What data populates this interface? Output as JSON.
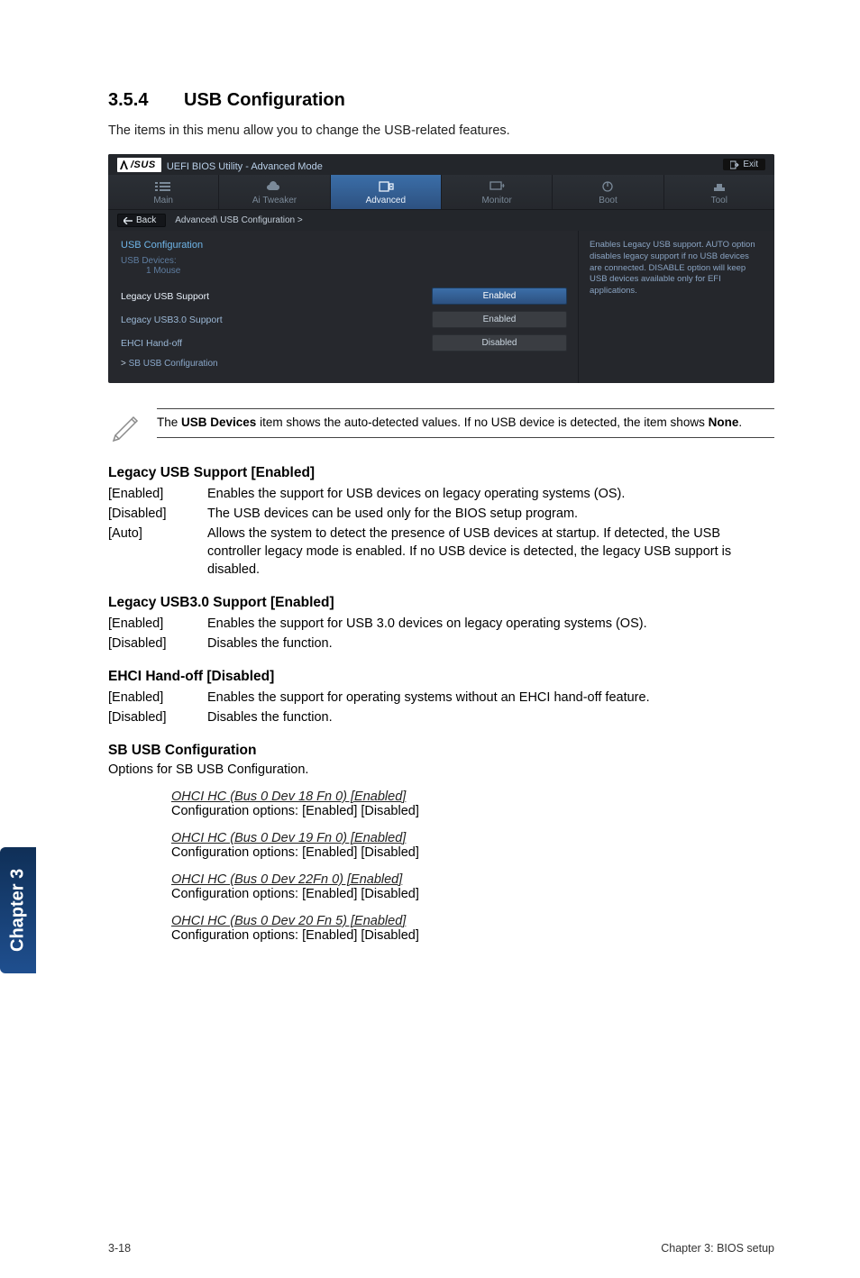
{
  "heading": {
    "number": "3.5.4",
    "title": "USB Configuration"
  },
  "intro": "The items in this menu allow you to change the USB-related features.",
  "bios": {
    "brand": "/SUS",
    "utility_title": "UEFI BIOS Utility - Advanced Mode",
    "exit_label": "Exit",
    "tabs": [
      {
        "label": "Main"
      },
      {
        "label": "Ai Tweaker"
      },
      {
        "label": "Advanced"
      },
      {
        "label": "Monitor"
      },
      {
        "label": "Boot"
      },
      {
        "label": "Tool"
      }
    ],
    "back_label": "Back",
    "breadcrumb": "Advanced\\ USB Configuration >",
    "left": {
      "cfg_heading": "USB Configuration",
      "usb_devices_label": "USB Devices:",
      "usb_devices_value": "1 Mouse",
      "options": [
        {
          "label": "Legacy USB Support",
          "value": "Enabled",
          "selected": true
        },
        {
          "label": "Legacy USB3.0 Support",
          "value": "Enabled",
          "selected": false
        },
        {
          "label": "EHCI Hand-off",
          "value": "Disabled",
          "selected": false
        }
      ],
      "sublink": "SB USB Configuration"
    },
    "right_help": "Enables Legacy USB support. AUTO option disables legacy support if no USB devices are connected. DISABLE option will keep USB devices available only for EFI applications."
  },
  "note": {
    "text_pre": "The ",
    "bold1": "USB Devices",
    "text_mid": " item shows the auto-detected values. If no USB device is detected, the item shows ",
    "bold2": "None",
    "text_post": "."
  },
  "sections": [
    {
      "title": "Legacy USB Support [Enabled]",
      "rows": [
        {
          "key": "[Enabled]",
          "val": "Enables the support for USB devices on legacy operating systems (OS)."
        },
        {
          "key": "[Disabled]",
          "val": "The USB devices can be used only for the BIOS setup program."
        },
        {
          "key": "[Auto]",
          "val": "Allows the system to detect the presence of USB devices at startup. If detected, the USB controller legacy mode is enabled. If no USB device is detected, the legacy USB support is disabled."
        }
      ]
    },
    {
      "title": "Legacy USB3.0 Support [Enabled]",
      "rows": [
        {
          "key": "[Enabled]",
          "val": "Enables the support for USB 3.0 devices on legacy operating systems (OS)."
        },
        {
          "key": "[Disabled]",
          "val": "Disables the function."
        }
      ]
    },
    {
      "title": "EHCI Hand-off [Disabled]",
      "rows": [
        {
          "key": "[Enabled]",
          "val": "Enables the support for operating systems without an EHCI hand-off feature."
        },
        {
          "key": "[Disabled]",
          "val": "Disables the function."
        }
      ]
    }
  ],
  "sb_section": {
    "title": "SB USB Configuration",
    "body": "Options for SB USB Configuration.",
    "items": [
      {
        "title": "OHCI HC (Bus 0 Dev 18 Fn 0) [Enabled]",
        "body": "Configuration options: [Enabled] [Disabled]"
      },
      {
        "title": "OHCI HC (Bus 0 Dev 19 Fn 0) [Enabled]",
        "body": "Configuration options: [Enabled] [Disabled]"
      },
      {
        "title": "OHCI HC (Bus 0 Dev 22Fn 0) [Enabled]",
        "body": "Configuration options: [Enabled] [Disabled]"
      },
      {
        "title": "OHCI HC (Bus 0 Dev 20 Fn 5) [Enabled]",
        "body": "Configuration options: [Enabled] [Disabled]"
      }
    ]
  },
  "side_tab": "Chapter 3",
  "footer": {
    "left": "3-18",
    "right": "Chapter 3: BIOS setup"
  }
}
